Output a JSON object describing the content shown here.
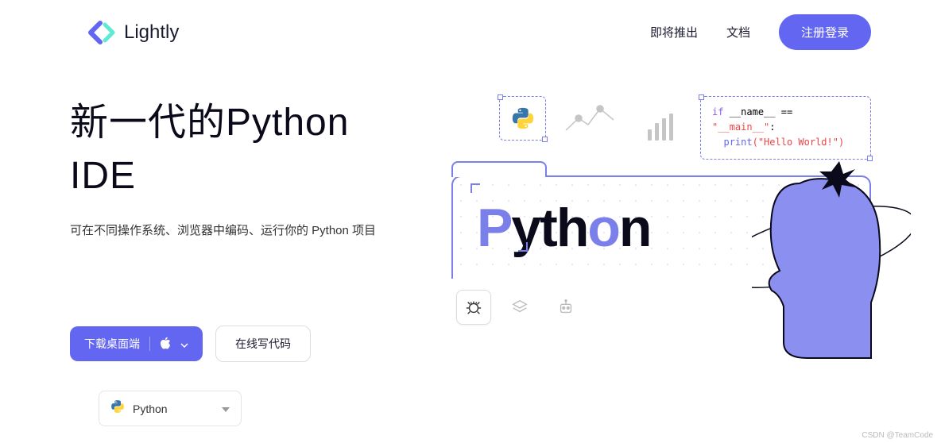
{
  "header": {
    "brand": "Lightly",
    "nav": {
      "coming_soon": "即将推出",
      "docs": "文档"
    },
    "signup": "注册登录"
  },
  "hero": {
    "title_line1": "新一代的Python",
    "title_line2": "IDE",
    "subtitle": "可在不同操作系统、浏览器中编码、运行你的 Python 项目"
  },
  "actions": {
    "download": "下载桌面端",
    "online": "在线写代码"
  },
  "language_select": {
    "selected": "Python"
  },
  "code_snippet": {
    "line1_if": "if",
    "line1_name": "__name__",
    "line1_eq": "==",
    "line1_main": "\"__main__\"",
    "line1_colon": ":",
    "line2_fn": "print",
    "line2_arg": "(\"Hello World!\")"
  },
  "illustration": {
    "big_word": "Python"
  },
  "watermark": "CSDN @TeamCode"
}
